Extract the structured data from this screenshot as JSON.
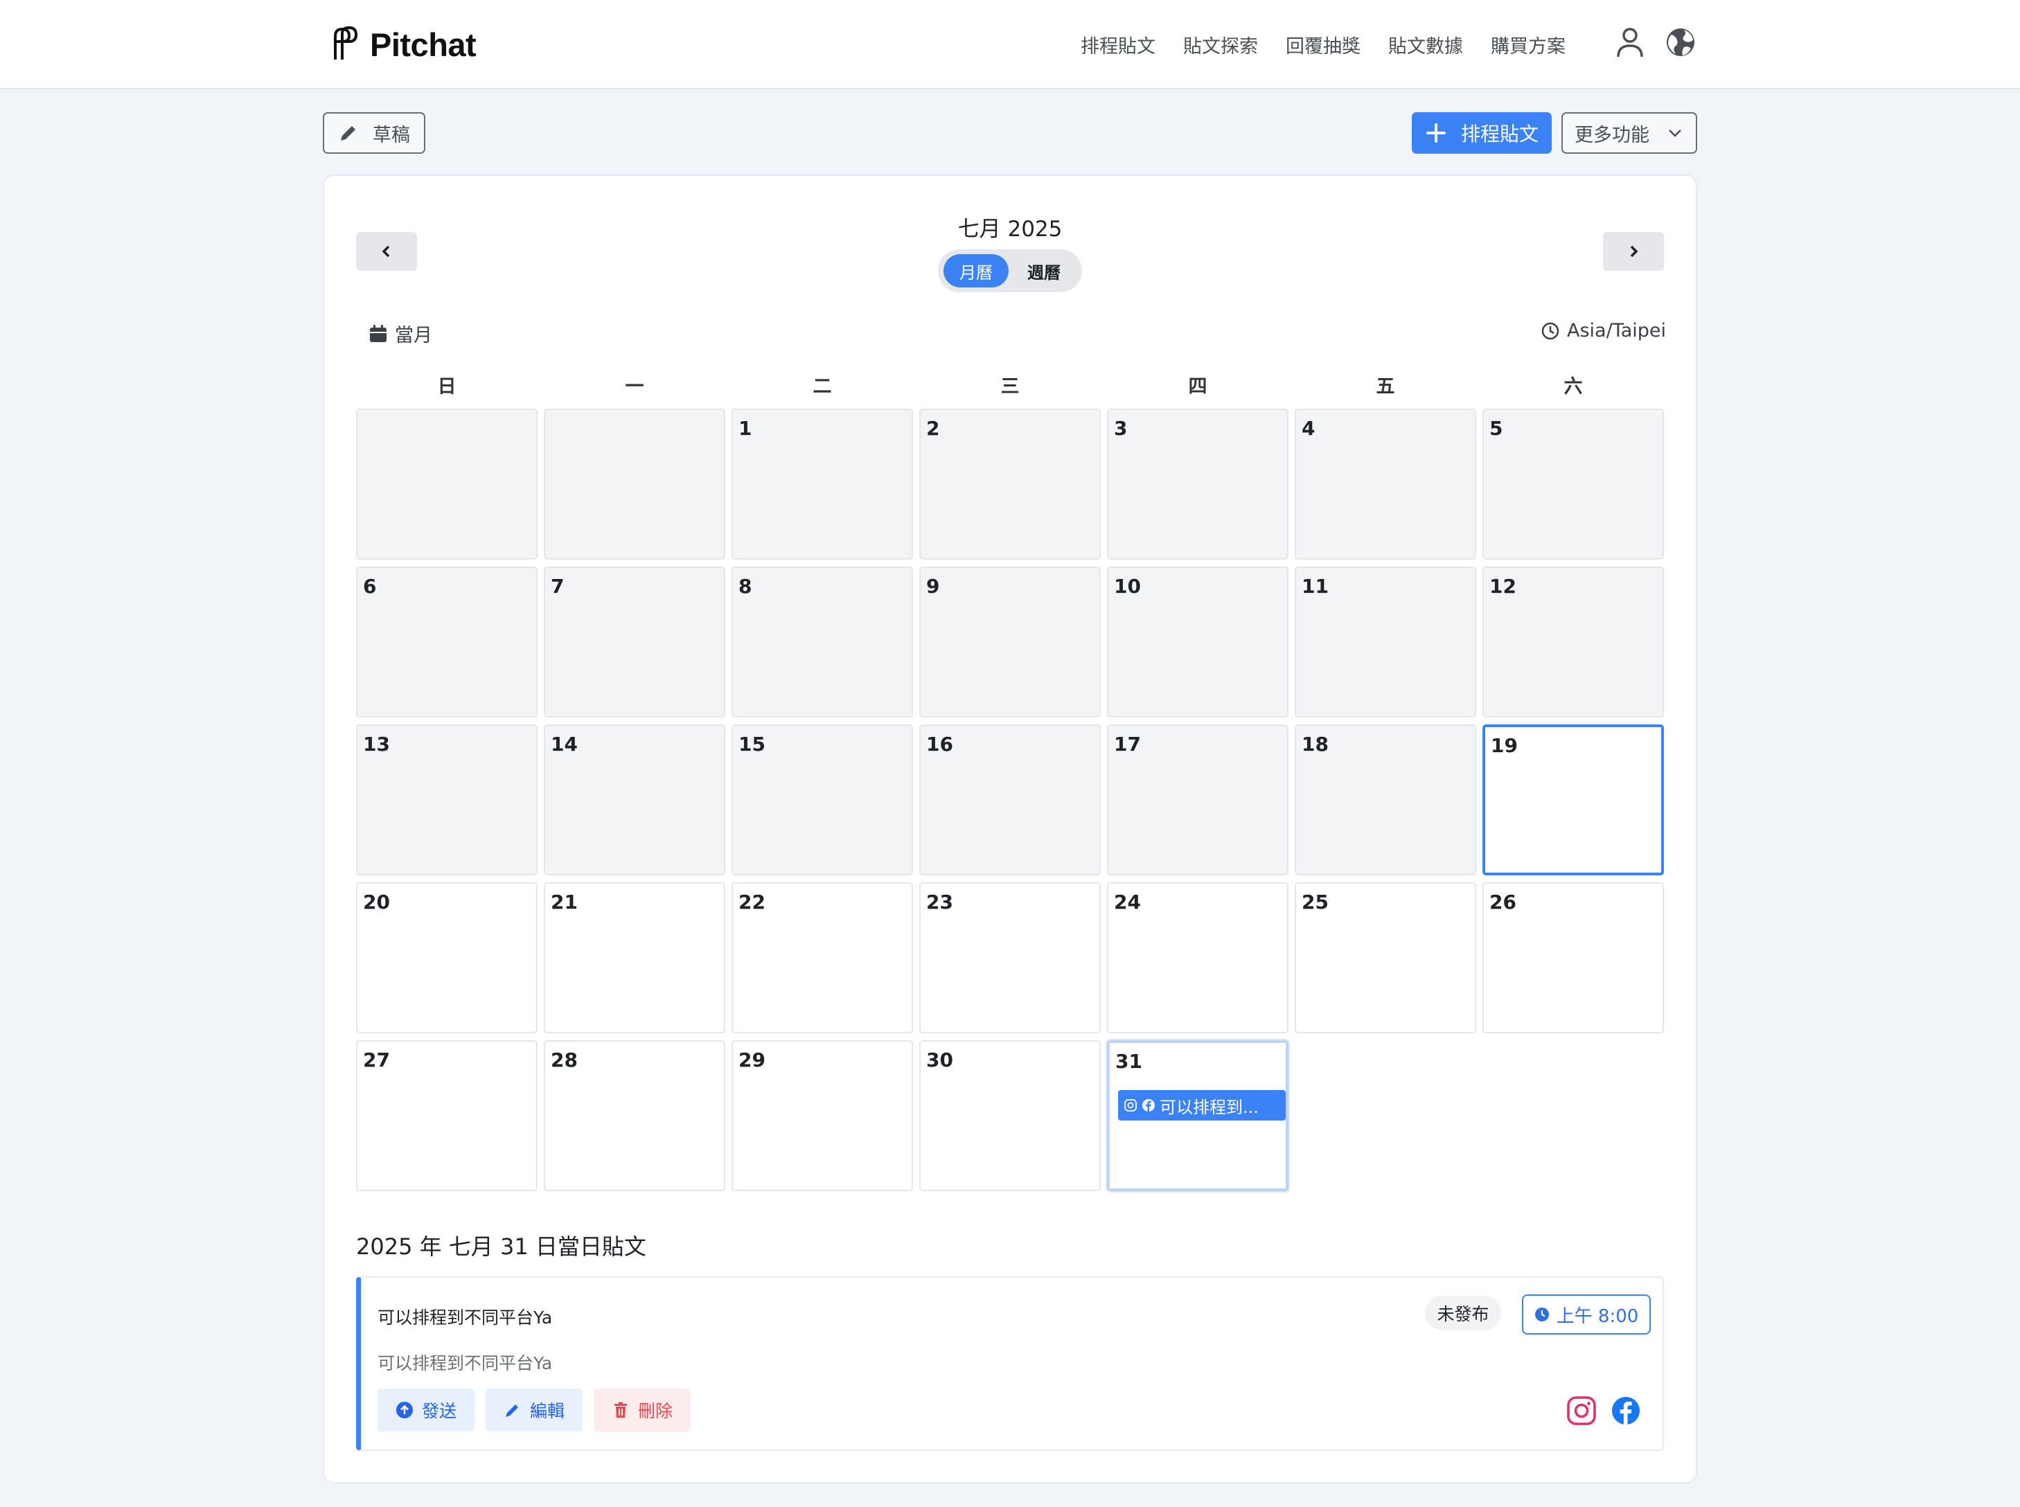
{
  "brand": {
    "name": "Pitchat"
  },
  "nav": {
    "links": [
      "排程貼文",
      "貼文探索",
      "回覆抽獎",
      "貼文數據",
      "購買方案"
    ]
  },
  "toolbar": {
    "draft_label": "草稿",
    "schedule_label": "排程貼文",
    "more_label": "更多功能"
  },
  "calendar": {
    "title": "七月 2025",
    "view_month": "月曆",
    "view_week": "週曆",
    "current_month_label": "當月",
    "timezone": "Asia/Taipei",
    "weekdays": [
      "日",
      "一",
      "二",
      "三",
      "四",
      "五",
      "六"
    ],
    "days": {
      "d1": "1",
      "d2": "2",
      "d3": "3",
      "d4": "4",
      "d5": "5",
      "d6": "6",
      "d7": "7",
      "d8": "8",
      "d9": "9",
      "d10": "10",
      "d11": "11",
      "d12": "12",
      "d13": "13",
      "d14": "14",
      "d15": "15",
      "d16": "16",
      "d17": "17",
      "d18": "18",
      "d19": "19",
      "d20": "20",
      "d21": "21",
      "d22": "22",
      "d23": "23",
      "d24": "24",
      "d25": "25",
      "d26": "26",
      "d27": "27",
      "d28": "28",
      "d29": "29",
      "d30": "30",
      "d31": "31"
    },
    "event_31": "可以排程到..."
  },
  "day_posts": {
    "heading": "2025 年 七月 31 日當日貼文",
    "post": {
      "title": "可以排程到不同平台Ya",
      "body": "可以排程到不同平台Ya",
      "status": "未發布",
      "time": "上午 8:00",
      "send_label": "發送",
      "edit_label": "編輯",
      "delete_label": "刪除"
    }
  },
  "colors": {
    "accent": "#3b82f6",
    "danger": "#e5484d",
    "instagram": "#e1306c",
    "facebook": "#1877f2"
  }
}
